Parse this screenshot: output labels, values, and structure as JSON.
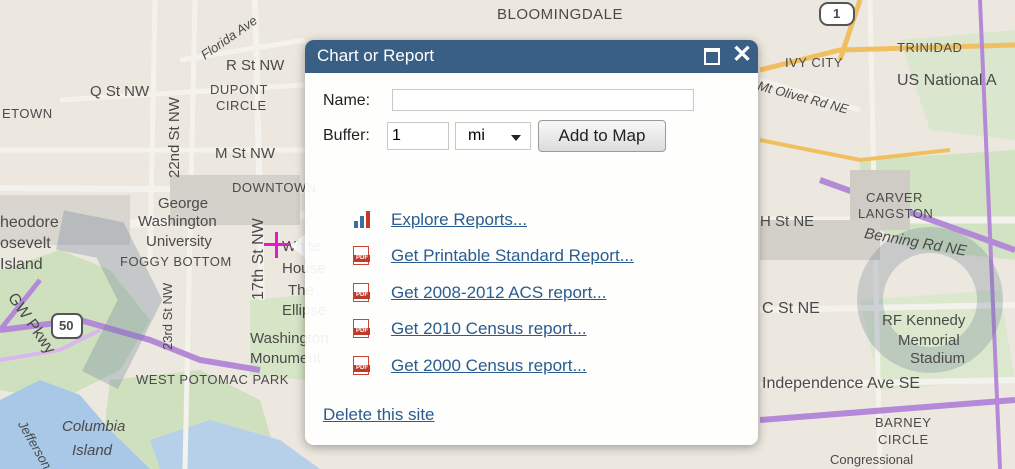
{
  "map": {
    "labels": {
      "bloomingdale": "BLOOMINGDALE",
      "florida_ave": "Florida Ave",
      "r_st_nw": "R St NW",
      "q_st_nw": "Q St NW",
      "dupont": "DUPONT",
      "circle": "CIRCLE",
      "georgetown": "ETOWN",
      "st_22nd": "22nd St NW",
      "m_st_nw": "M St NW",
      "downtown": "DOWNTOWN",
      "george": "George",
      "washington": "Washington",
      "university": "University",
      "foggy_bottom": "FOGGY BOTTOM",
      "theodore": "heodore",
      "roosevelt": "osevelt",
      "island": "Island",
      "st_17th": "17th St NW",
      "white_house_1": "White",
      "white_house_2": "House",
      "ellipse_1": "The",
      "ellipse_2": "Ellipse",
      "st_23rd": "23rd St NW",
      "route_50": "50",
      "washington_monument_1": "Washington",
      "washington_monument_2": "Monument",
      "west_potomac": "WEST POTOMAC PARK",
      "gw_pkwy": "GW Pkwy",
      "columbia": "Columbia",
      "columbia_island": "Island",
      "jefferson": "Jefferson",
      "ivy_city": "IVY CITY",
      "trinidad": "TRINIDAD",
      "us_national": "US National A",
      "mt_olivet": "Mt Olivet Rd NE",
      "h_st_ne": "H St NE",
      "carver": "CARVER",
      "langston": "LANGSTON",
      "benning": "Benning Rd NE",
      "c_st_ne": "C St NE",
      "rf_kennedy_1": "RF Kennedy",
      "rf_kennedy_2": "Memorial",
      "rf_kennedy_3": "Stadium",
      "independence": "Independence Ave SE",
      "barney": "BARNEY",
      "barney_circle": "CIRCLE",
      "congressional": "Congressional",
      "route_1": "1"
    }
  },
  "popup": {
    "title": "Chart or Report",
    "name_label": "Name:",
    "name_value": "",
    "buffer_label": "Buffer:",
    "buffer_value": "1",
    "unit_value": "mi",
    "add_button": "Add to Map",
    "reports": [
      {
        "label": "Explore Reports...",
        "icon": "bar-chart-icon"
      },
      {
        "label": "Get Printable Standard Report...",
        "icon": "pdf-icon"
      },
      {
        "label": "Get 2008-2012 ACS report...",
        "icon": "pdf-icon"
      },
      {
        "label": "Get 2010 Census report...",
        "icon": "pdf-icon"
      },
      {
        "label": "Get 2000 Census report...",
        "icon": "pdf-icon"
      }
    ],
    "delete_link": "Delete this site",
    "header_color": "#3a5f84",
    "link_color": "#2a5c90"
  },
  "marker_color": "#e619c8"
}
